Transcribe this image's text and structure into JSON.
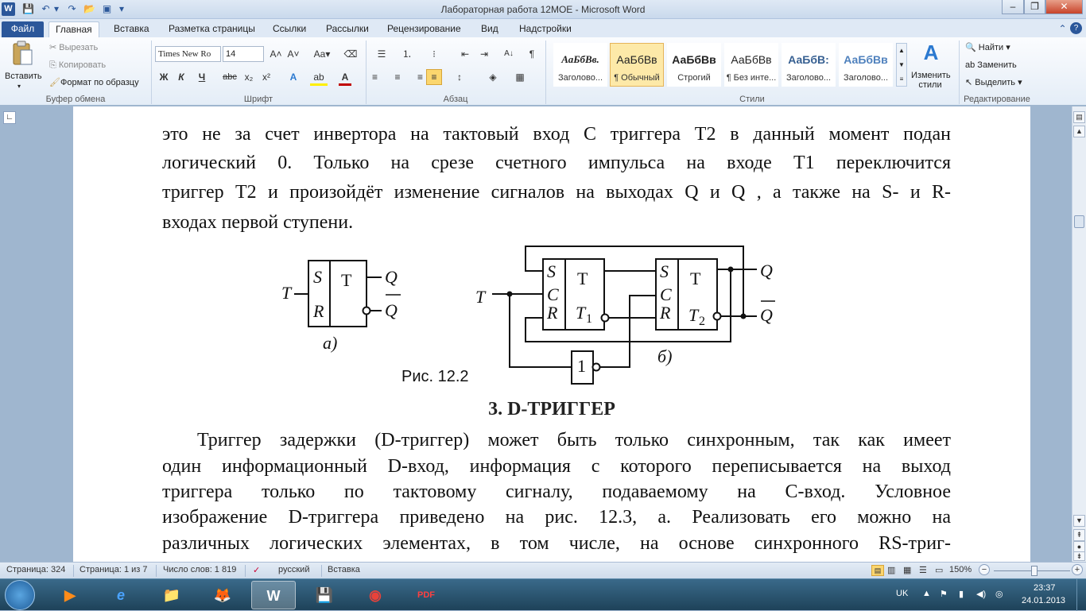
{
  "window": {
    "title": "Лабораторная работа 12МОЕ - Microsoft Word",
    "app_letter": "W",
    "min": "–",
    "max": "❐",
    "close": "✕"
  },
  "qa": {
    "save": "💾",
    "undo": "↶",
    "undo_more": "▾",
    "redo": "↷",
    "open": "📂",
    "print": "▣",
    "customize": "▾"
  },
  "tabs": [
    "Файл",
    "Главная",
    "Вставка",
    "Разметка страницы",
    "Ссылки",
    "Рассылки",
    "Рецензирование",
    "Вид",
    "Надстройки"
  ],
  "ribbon_right": {
    "minimize": "⌃",
    "help": "?"
  },
  "clipboard": {
    "paste": "Вставить",
    "paste_arrow": "▾",
    "cut": "Вырезать",
    "copy": "Копировать",
    "format_painter": "Формат по образцу",
    "label": "Буфер обмена"
  },
  "font": {
    "name": "Times New Ro",
    "size": "14",
    "grow": "A˄",
    "shrink": "A˅",
    "case": "Aa▾",
    "clear": "⌫",
    "bold": "Ж",
    "italic": "К",
    "underline": "Ч",
    "strike": "abc",
    "sub": "x₂",
    "sup": "x²",
    "effects": "A",
    "highlight": "ab",
    "color": "A",
    "label": "Шрифт"
  },
  "paragraph": {
    "bullets": "☰",
    "numbering": "⒈",
    "multilevel": "⁝",
    "decrease_indent": "⇤",
    "increase_indent": "⇥",
    "sort": "A↓",
    "marks": "¶",
    "align_left": "≡",
    "center": "≡",
    "align_right": "≡",
    "justify": "≡",
    "spacing": "↕",
    "shading": "◈",
    "borders": "▦",
    "label": "Абзац"
  },
  "styles": {
    "items": [
      {
        "sample": "АаБбВв.",
        "name": "Заголово..."
      },
      {
        "sample": "АаБбВв",
        "name": "¶ Обычный"
      },
      {
        "sample": "АаБбВв",
        "name": "Строгий"
      },
      {
        "sample": "АаБбВв",
        "name": "¶ Без инте..."
      },
      {
        "sample": "АаБбВ:",
        "name": "Заголово..."
      },
      {
        "sample": "АаБбВв",
        "name": "Заголово..."
      }
    ],
    "change": "Изменить стили",
    "change_arrow": "▾",
    "label": "Стили"
  },
  "editing": {
    "find": "Найти",
    "replace": "Заменить",
    "select": "Выделить",
    "label": "Редактирование"
  },
  "document": {
    "lines": [
      "это не за счет инвертора на тактовый вход C триггера T2 в данный момент подан",
      "логический 0. Только на срезе счетного импульса на входе T1 переключится",
      "триггер T2 и произойдёт изменение сигналов на выходах Q и Q , а также на S- и R-",
      "входах первой ступени."
    ],
    "figure": {
      "a": {
        "S": "S",
        "R": "R",
        "T": "T",
        "Q": "Q",
        "Qbar": "Q",
        "input": "T",
        "caption": "а)"
      },
      "b": {
        "S1": "S",
        "C1": "C",
        "R1": "R",
        "T1": "T",
        "T1sub": "T",
        "T1idx": "1",
        "S2": "S",
        "C2": "C",
        "R2": "R",
        "T2": "T",
        "T2sub": "T",
        "T2idx": "2",
        "input": "T",
        "Q": "Q",
        "Qbar": "Q",
        "inv": "1",
        "caption": "б)"
      },
      "caption": "Рис. 12.2"
    },
    "heading": "3. D-ТРИГГЕР",
    "body": [
      "Триггер задержки (D-триггер) может быть только синхронным, так как имеет",
      "один информационный D-вход, информация с которого переписывается на выход",
      "триггера только по тактовому сигналу, подаваемому на         С-вход. Условное",
      "изображение D-триггера приведено на рис. 12.3, а. Реализовать его можно на",
      "различных логических элементах, в том числе, на основе синхронного RS-триг-"
    ]
  },
  "status": {
    "page": "Страница: 324",
    "pages": "Страница: 1 из 7",
    "words": "Число слов: 1 819",
    "lang": "русский",
    "insert": "Вставка",
    "zoom": "150%"
  },
  "taskbar": {
    "apps": [
      "▶",
      "e",
      "📁",
      "🦊",
      "W",
      "💾",
      "◉",
      "PDF"
    ],
    "lang": "UK",
    "time": "23:37",
    "date": "24.01.2013"
  }
}
